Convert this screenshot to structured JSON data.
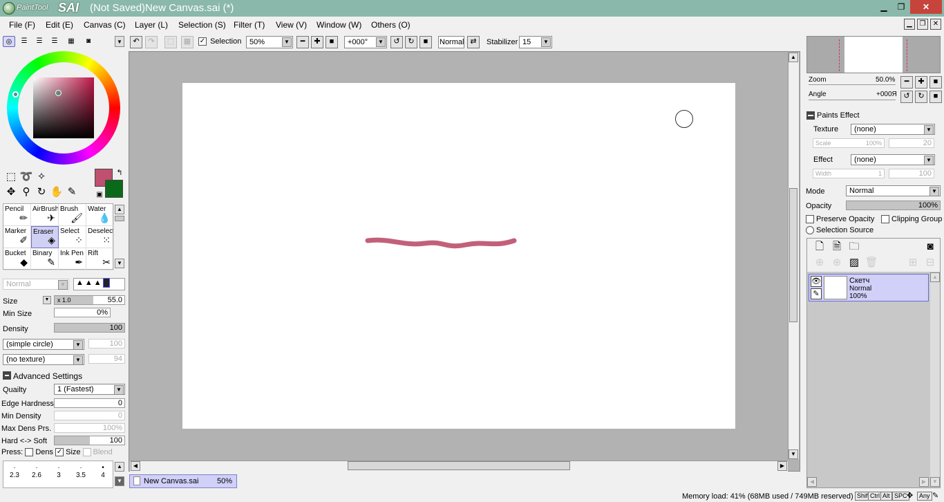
{
  "app": {
    "logo_small": "PaintTool",
    "logo_big": "SAI",
    "window_title": "(Not Saved)New Canvas.sai (*)"
  },
  "menu": [
    "File (F)",
    "Edit (E)",
    "Canvas (C)",
    "Layer (L)",
    "Selection (S)",
    "Filter (T)",
    "View (V)",
    "Window (W)",
    "Others (O)"
  ],
  "toolbar": {
    "selection_label": "Selection",
    "zoom_value": "50%",
    "angle_value": "+000°",
    "blend_value": "Normal",
    "stabilizer_label": "Stabilizer",
    "stabilizer_value": "15"
  },
  "colors": {
    "foreground": "#c05070",
    "background": "#0a6a1a"
  },
  "tools": [
    {
      "label": "Pencil",
      "icon": "pencil-icon"
    },
    {
      "label": "AirBrush",
      "icon": "airbrush-icon"
    },
    {
      "label": "Brush",
      "icon": "brush-icon"
    },
    {
      "label": "Water",
      "icon": "water-icon"
    },
    {
      "label": "Marker",
      "icon": "marker-icon"
    },
    {
      "label": "Eraser",
      "icon": "eraser-icon"
    },
    {
      "label": "Select",
      "icon": "select-icon"
    },
    {
      "label": "Deselect",
      "icon": "deselect-icon"
    },
    {
      "label": "Bucket",
      "icon": "bucket-icon"
    },
    {
      "label": "Binary",
      "icon": "binary-icon"
    },
    {
      "label": "Ink Pen",
      "icon": "ink-pen-icon"
    },
    {
      "label": "Rift",
      "icon": "rift-icon"
    }
  ],
  "tool_props": {
    "blend_mode": "Normal",
    "size_label": "Size",
    "size_mult": "x 1.0",
    "size_value": "55.0",
    "min_size_label": "Min Size",
    "min_size_value": "0%",
    "density_label": "Density",
    "density_value": "100",
    "shape": "(simple circle)",
    "shape_value": "100",
    "texture": "(no texture)",
    "texture_value": "94",
    "advanced_label": "Advanced Settings",
    "quality_label": "Quailty",
    "quality_value": "1 (Fastest)",
    "edge_label": "Edge Hardness",
    "edge_value": "0",
    "min_density_label": "Min Density",
    "min_density_value": "0",
    "max_dens_label": "Max Dens Prs.",
    "max_dens_value": "100%",
    "hard_soft_label": "Hard <-> Soft",
    "hard_soft_value": "100",
    "press_label": "Press:",
    "press_dens": "Dens",
    "press_size": "Size",
    "press_blend": "Blend",
    "brush_sizes": [
      "2.3",
      "2.6",
      "3",
      "3.5",
      "4"
    ]
  },
  "document_tab": {
    "name": "New Canvas.sai",
    "zoom": "50%"
  },
  "navigator": {
    "zoom_label": "Zoom",
    "zoom_value": "50.0%",
    "angle_label": "Angle",
    "angle_value": "+000Я"
  },
  "paints_effect": {
    "header": "Paints Effect",
    "texture_label": "Texture",
    "texture_value": "(none)",
    "scale_label": "Scale",
    "scale_value": "100%",
    "scale_value2": "20",
    "effect_label": "Effect",
    "effect_value": "(none)",
    "width_label": "Width",
    "width_value": "1",
    "width_value2": "100"
  },
  "layer_props": {
    "mode_label": "Mode",
    "mode_value": "Normal",
    "opacity_label": "Opacity",
    "opacity_value": "100%",
    "preserve_opacity": "Preserve Opacity",
    "clipping_group": "Clipping Group",
    "selection_source": "Selection Source"
  },
  "layers": [
    {
      "name": "Скетч",
      "mode": "Normal",
      "opacity": "100%"
    }
  ],
  "status": {
    "memory": "Memory load: 41% (68MB used / 749MB reserved)",
    "keys": [
      "Shift",
      "Ctrl",
      "Alt",
      "SPC",
      "Any"
    ]
  }
}
